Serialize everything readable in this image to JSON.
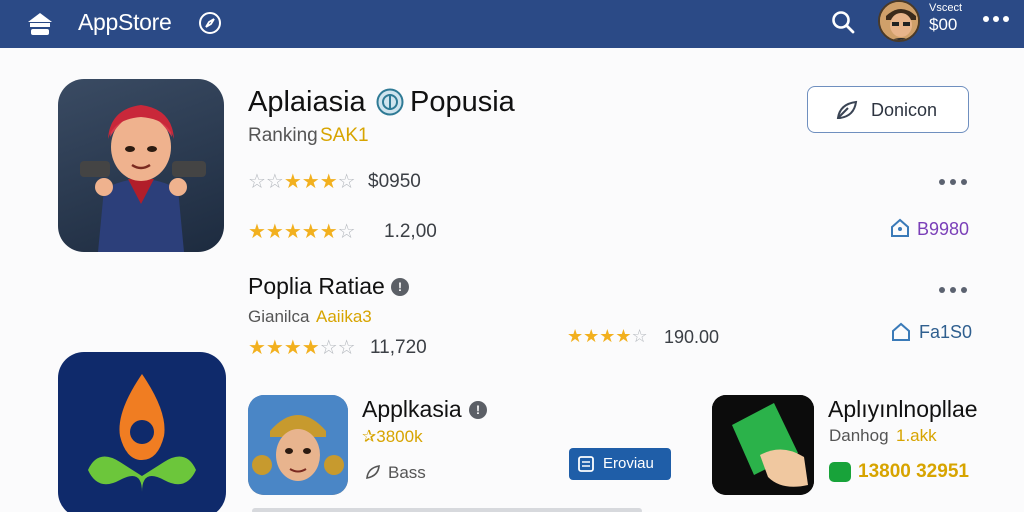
{
  "colors": {
    "topbar": "#2b4a86",
    "star": "#f2b01e",
    "star_off": "#b4b8be",
    "accent_yellow": "#d7a400",
    "link_blue": "#1f5ea8"
  },
  "header": {
    "title": "AppStore",
    "home_icon": "store-home-icon",
    "compass_icon": "compass-icon",
    "search_icon": "search-icon",
    "user_label": "Vscect",
    "user_balance": "$00",
    "more_icon": "more-dots-icon"
  },
  "featured": {
    "title_part1": "Aplaiasia",
    "title_part2": "Popusia",
    "ranking_label": "Ranking",
    "ranking_value": "SAK1",
    "row1_rating": 4,
    "row1_value": "$0950",
    "row2_rating": 4.5,
    "row2_value": "1.2,00",
    "download_label": "Donicon",
    "tag_value": "B9980"
  },
  "section": {
    "title": "Poplia Ratiae",
    "sub_label": "Gianilca",
    "sub_value": "Aaiika3",
    "row_rating": 3.5,
    "row_value": "11,720",
    "mid_rating": 4,
    "mid_value": "190.00",
    "tag_value": "Fa1S0"
  },
  "app3": {
    "title": "Applkasia",
    "price": "✰3800k",
    "meta": "Bass",
    "preview_label": "Eroviau"
  },
  "app4": {
    "title": "Aplıyınlnopllae",
    "sub_label": "Danhog",
    "sub_value": "1.akk",
    "price": "13800 32951"
  }
}
